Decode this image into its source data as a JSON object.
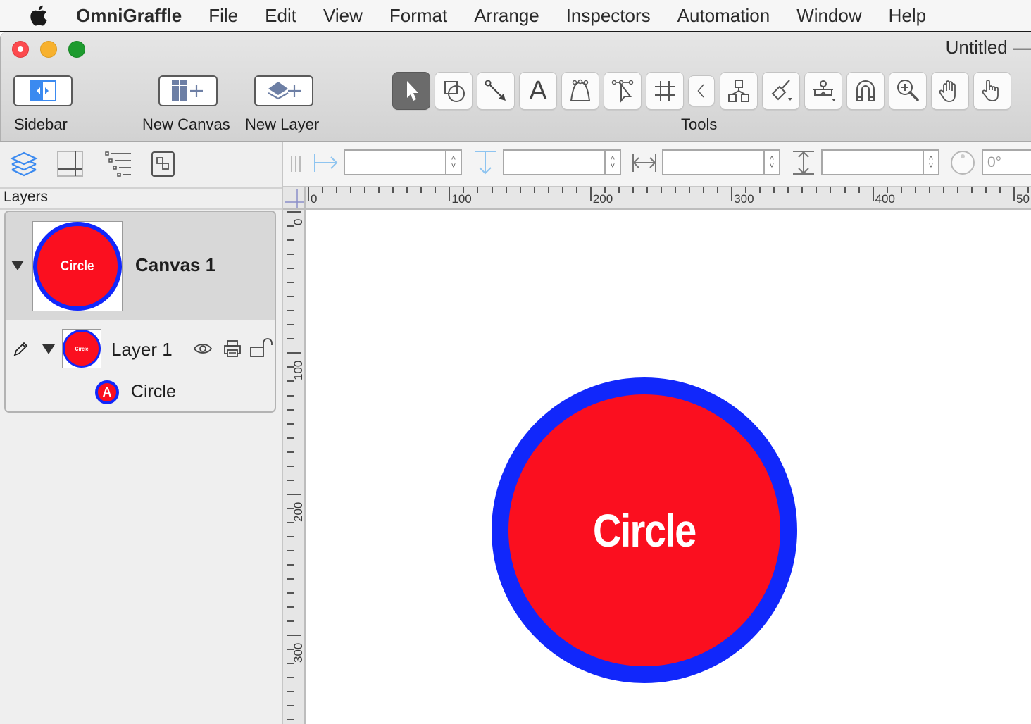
{
  "menubar": {
    "app_name": "OmniGraffle",
    "items": [
      "File",
      "Edit",
      "View",
      "Format",
      "Arrange",
      "Inspectors",
      "Automation",
      "Window",
      "Help"
    ]
  },
  "window": {
    "title": "Untitled —"
  },
  "toolbar": {
    "sidebar_label": "Sidebar",
    "new_canvas_label": "New Canvas",
    "new_layer_label": "New Layer",
    "tools_label": "Tools",
    "tools": [
      {
        "name": "selection-tool",
        "active": true
      },
      {
        "name": "shape-tool",
        "active": false
      },
      {
        "name": "line-tool",
        "active": false
      },
      {
        "name": "text-tool",
        "active": false
      },
      {
        "name": "pen-tool",
        "active": false
      },
      {
        "name": "point-editor-tool",
        "active": false
      },
      {
        "name": "diagram-grid-tool",
        "active": false
      },
      {
        "name": "collapse-tools",
        "active": false
      },
      {
        "name": "diagram-tool",
        "active": false
      },
      {
        "name": "style-brush-tool",
        "active": false
      },
      {
        "name": "rubber-stamp-tool",
        "active": false
      },
      {
        "name": "magnet-tool",
        "active": false
      },
      {
        "name": "zoom-tool",
        "active": false
      },
      {
        "name": "hand-tool",
        "active": false
      },
      {
        "name": "browse-tool",
        "active": false
      }
    ],
    "text_tool_glyph": "A"
  },
  "sidebar": {
    "tabs": [
      "layers",
      "canvas",
      "outline",
      "objects"
    ],
    "active_tab": "layers",
    "section_title": "Layers",
    "canvas": {
      "name": "Canvas 1",
      "thumb_text": "Circle"
    },
    "layer": {
      "name": "Layer 1",
      "thumb_text": "Circle"
    },
    "object": {
      "name": "Circle",
      "icon_glyph": "A"
    }
  },
  "inspector_bar": {
    "x_value": "",
    "y_value": "",
    "width_value": "",
    "height_value": "",
    "rotation_value": "0°",
    "stepper_up": "˄",
    "stepper_down": "˅"
  },
  "rulers": {
    "horizontal": [
      "0",
      "100",
      "200",
      "300",
      "400",
      "50"
    ],
    "vertical": [
      "0",
      "100",
      "200",
      "300"
    ]
  },
  "canvas": {
    "shape_text": "Circle",
    "fill_color": "#fb0f1f",
    "stroke_color": "#1127fb",
    "text_color": "#ffffff"
  },
  "colors": {
    "accent_blue": "#3b8af0",
    "traffic_close": "#fc4a4e",
    "traffic_min": "#f7b12e",
    "traffic_max": "#1d9b2e"
  }
}
